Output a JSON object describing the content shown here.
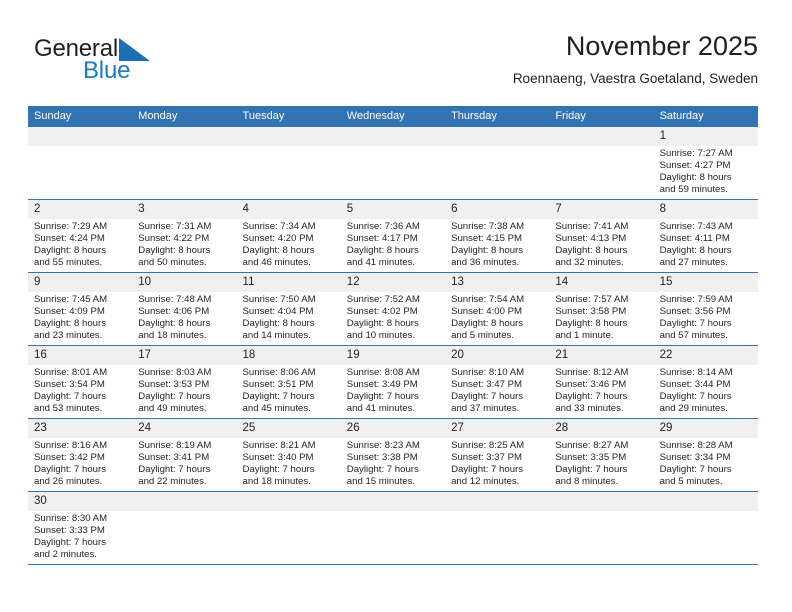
{
  "brand": {
    "name_part1": "General",
    "name_part2": "Blue",
    "triangle_color": "#1a6fb5"
  },
  "header": {
    "title": "November 2025",
    "subtitle": "Roennaeng, Vaestra Goetaland, Sweden",
    "accent_color": "#3273b3"
  },
  "calendar": {
    "day_headers": [
      "Sunday",
      "Monday",
      "Tuesday",
      "Wednesday",
      "Thursday",
      "Friday",
      "Saturday"
    ],
    "weeks": [
      [
        {
          "day": "",
          "lines": []
        },
        {
          "day": "",
          "lines": []
        },
        {
          "day": "",
          "lines": []
        },
        {
          "day": "",
          "lines": []
        },
        {
          "day": "",
          "lines": []
        },
        {
          "day": "",
          "lines": []
        },
        {
          "day": "1",
          "lines": [
            "Sunrise: 7:27 AM",
            "Sunset: 4:27 PM",
            "Daylight: 8 hours",
            "and 59 minutes."
          ]
        }
      ],
      [
        {
          "day": "2",
          "lines": [
            "Sunrise: 7:29 AM",
            "Sunset: 4:24 PM",
            "Daylight: 8 hours",
            "and 55 minutes."
          ]
        },
        {
          "day": "3",
          "lines": [
            "Sunrise: 7:31 AM",
            "Sunset: 4:22 PM",
            "Daylight: 8 hours",
            "and 50 minutes."
          ]
        },
        {
          "day": "4",
          "lines": [
            "Sunrise: 7:34 AM",
            "Sunset: 4:20 PM",
            "Daylight: 8 hours",
            "and 46 minutes."
          ]
        },
        {
          "day": "5",
          "lines": [
            "Sunrise: 7:36 AM",
            "Sunset: 4:17 PM",
            "Daylight: 8 hours",
            "and 41 minutes."
          ]
        },
        {
          "day": "6",
          "lines": [
            "Sunrise: 7:38 AM",
            "Sunset: 4:15 PM",
            "Daylight: 8 hours",
            "and 36 minutes."
          ]
        },
        {
          "day": "7",
          "lines": [
            "Sunrise: 7:41 AM",
            "Sunset: 4:13 PM",
            "Daylight: 8 hours",
            "and 32 minutes."
          ]
        },
        {
          "day": "8",
          "lines": [
            "Sunrise: 7:43 AM",
            "Sunset: 4:11 PM",
            "Daylight: 8 hours",
            "and 27 minutes."
          ]
        }
      ],
      [
        {
          "day": "9",
          "lines": [
            "Sunrise: 7:45 AM",
            "Sunset: 4:09 PM",
            "Daylight: 8 hours",
            "and 23 minutes."
          ]
        },
        {
          "day": "10",
          "lines": [
            "Sunrise: 7:48 AM",
            "Sunset: 4:06 PM",
            "Daylight: 8 hours",
            "and 18 minutes."
          ]
        },
        {
          "day": "11",
          "lines": [
            "Sunrise: 7:50 AM",
            "Sunset: 4:04 PM",
            "Daylight: 8 hours",
            "and 14 minutes."
          ]
        },
        {
          "day": "12",
          "lines": [
            "Sunrise: 7:52 AM",
            "Sunset: 4:02 PM",
            "Daylight: 8 hours",
            "and 10 minutes."
          ]
        },
        {
          "day": "13",
          "lines": [
            "Sunrise: 7:54 AM",
            "Sunset: 4:00 PM",
            "Daylight: 8 hours",
            "and 5 minutes."
          ]
        },
        {
          "day": "14",
          "lines": [
            "Sunrise: 7:57 AM",
            "Sunset: 3:58 PM",
            "Daylight: 8 hours",
            "and 1 minute."
          ]
        },
        {
          "day": "15",
          "lines": [
            "Sunrise: 7:59 AM",
            "Sunset: 3:56 PM",
            "Daylight: 7 hours",
            "and 57 minutes."
          ]
        }
      ],
      [
        {
          "day": "16",
          "lines": [
            "Sunrise: 8:01 AM",
            "Sunset: 3:54 PM",
            "Daylight: 7 hours",
            "and 53 minutes."
          ]
        },
        {
          "day": "17",
          "lines": [
            "Sunrise: 8:03 AM",
            "Sunset: 3:53 PM",
            "Daylight: 7 hours",
            "and 49 minutes."
          ]
        },
        {
          "day": "18",
          "lines": [
            "Sunrise: 8:06 AM",
            "Sunset: 3:51 PM",
            "Daylight: 7 hours",
            "and 45 minutes."
          ]
        },
        {
          "day": "19",
          "lines": [
            "Sunrise: 8:08 AM",
            "Sunset: 3:49 PM",
            "Daylight: 7 hours",
            "and 41 minutes."
          ]
        },
        {
          "day": "20",
          "lines": [
            "Sunrise: 8:10 AM",
            "Sunset: 3:47 PM",
            "Daylight: 7 hours",
            "and 37 minutes."
          ]
        },
        {
          "day": "21",
          "lines": [
            "Sunrise: 8:12 AM",
            "Sunset: 3:46 PM",
            "Daylight: 7 hours",
            "and 33 minutes."
          ]
        },
        {
          "day": "22",
          "lines": [
            "Sunrise: 8:14 AM",
            "Sunset: 3:44 PM",
            "Daylight: 7 hours",
            "and 29 minutes."
          ]
        }
      ],
      [
        {
          "day": "23",
          "lines": [
            "Sunrise: 8:16 AM",
            "Sunset: 3:42 PM",
            "Daylight: 7 hours",
            "and 26 minutes."
          ]
        },
        {
          "day": "24",
          "lines": [
            "Sunrise: 8:19 AM",
            "Sunset: 3:41 PM",
            "Daylight: 7 hours",
            "and 22 minutes."
          ]
        },
        {
          "day": "25",
          "lines": [
            "Sunrise: 8:21 AM",
            "Sunset: 3:40 PM",
            "Daylight: 7 hours",
            "and 18 minutes."
          ]
        },
        {
          "day": "26",
          "lines": [
            "Sunrise: 8:23 AM",
            "Sunset: 3:38 PM",
            "Daylight: 7 hours",
            "and 15 minutes."
          ]
        },
        {
          "day": "27",
          "lines": [
            "Sunrise: 8:25 AM",
            "Sunset: 3:37 PM",
            "Daylight: 7 hours",
            "and 12 minutes."
          ]
        },
        {
          "day": "28",
          "lines": [
            "Sunrise: 8:27 AM",
            "Sunset: 3:35 PM",
            "Daylight: 7 hours",
            "and 8 minutes."
          ]
        },
        {
          "day": "29",
          "lines": [
            "Sunrise: 8:28 AM",
            "Sunset: 3:34 PM",
            "Daylight: 7 hours",
            "and 5 minutes."
          ]
        }
      ],
      [
        {
          "day": "30",
          "lines": [
            "Sunrise: 8:30 AM",
            "Sunset: 3:33 PM",
            "Daylight: 7 hours",
            "and 2 minutes."
          ]
        },
        {
          "day": "",
          "lines": []
        },
        {
          "day": "",
          "lines": []
        },
        {
          "day": "",
          "lines": []
        },
        {
          "day": "",
          "lines": []
        },
        {
          "day": "",
          "lines": []
        },
        {
          "day": "",
          "lines": []
        }
      ]
    ]
  }
}
